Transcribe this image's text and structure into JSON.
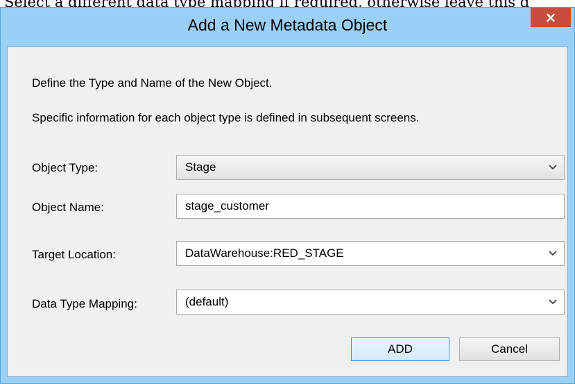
{
  "document": {
    "background_text": "Select a different data type mapping if required, otherwise leave this d"
  },
  "dialog": {
    "title": "Add a New Metadata Object",
    "close_glyph": "×",
    "intro_line1": "Define the Type and Name of the New Object.",
    "intro_line2": "Specific information for each object type is defined in subsequent screens."
  },
  "form": {
    "object_type": {
      "label": "Object Type:",
      "value": "Stage"
    },
    "object_name": {
      "label": "Object Name:",
      "value": "stage_customer"
    },
    "target_location": {
      "label": "Target Location:",
      "value": "DataWarehouse:RED_STAGE"
    },
    "data_type_mapping": {
      "label": "Data Type Mapping:",
      "value": "(default)"
    }
  },
  "buttons": {
    "add_label": "ADD",
    "cancel_label": "Cancel"
  },
  "colors": {
    "window_frame": "#9ad0f5",
    "close_button": "#c74e3c",
    "client_background": "#f0f0f0",
    "default_button_border": "#3c8fd6"
  },
  "icons": {
    "close": "close-icon",
    "dropdown": "chevron-down-icon"
  }
}
